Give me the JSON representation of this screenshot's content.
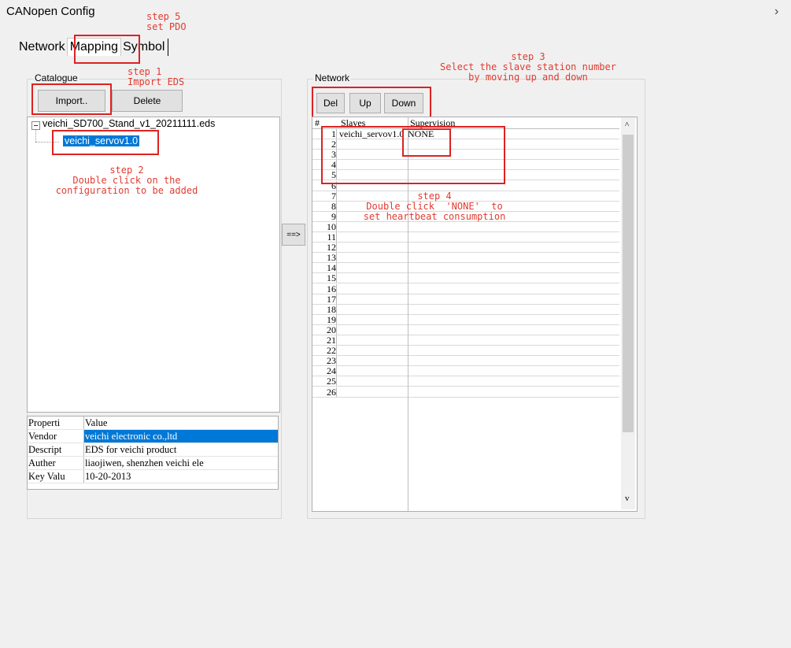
{
  "window": {
    "title": "CANopen Config",
    "close_glyph": "›"
  },
  "tabs": [
    {
      "label": "Network"
    },
    {
      "label": "Mapping"
    },
    {
      "label": "Symbol"
    }
  ],
  "catalogue": {
    "label": "Catalogue",
    "import_label": "Import..",
    "delete_label": "Delete",
    "tree_root": "veichi_SD700_Stand_v1_20211111.eds",
    "tree_child": "veichi_servov1.0",
    "properties": {
      "header": [
        "Properti",
        "Value"
      ],
      "rows": [
        [
          "Vendor",
          "veichi electronic co.,ltd"
        ],
        [
          "Descript",
          "EDS for veichi product"
        ],
        [
          "Auther",
          "liaojiwen, shenzhen veichi ele"
        ],
        [
          "Key Valu",
          "10-20-2013"
        ]
      ]
    }
  },
  "transfer_button": "==>",
  "network": {
    "label": "Network",
    "del_label": "Del",
    "up_label": "Up",
    "down_label": "Down",
    "columns": [
      "#",
      "Slaves",
      "Supervision"
    ],
    "rows": [
      {
        "n": "1",
        "slave": "veichi_servov1.0",
        "sup": "NONE"
      },
      {
        "n": "2",
        "slave": "",
        "sup": ""
      },
      {
        "n": "3",
        "slave": "",
        "sup": ""
      },
      {
        "n": "4",
        "slave": "",
        "sup": ""
      },
      {
        "n": "5",
        "slave": "",
        "sup": ""
      },
      {
        "n": "6",
        "slave": "",
        "sup": ""
      },
      {
        "n": "7",
        "slave": "",
        "sup": ""
      },
      {
        "n": "8",
        "slave": "",
        "sup": ""
      },
      {
        "n": "9",
        "slave": "",
        "sup": ""
      },
      {
        "n": "10",
        "slave": "",
        "sup": ""
      },
      {
        "n": "11",
        "slave": "",
        "sup": ""
      },
      {
        "n": "12",
        "slave": "",
        "sup": ""
      },
      {
        "n": "13",
        "slave": "",
        "sup": ""
      },
      {
        "n": "14",
        "slave": "",
        "sup": ""
      },
      {
        "n": "15",
        "slave": "",
        "sup": ""
      },
      {
        "n": "16",
        "slave": "",
        "sup": ""
      },
      {
        "n": "17",
        "slave": "",
        "sup": ""
      },
      {
        "n": "18",
        "slave": "",
        "sup": ""
      },
      {
        "n": "19",
        "slave": "",
        "sup": ""
      },
      {
        "n": "20",
        "slave": "",
        "sup": ""
      },
      {
        "n": "21",
        "slave": "",
        "sup": ""
      },
      {
        "n": "22",
        "slave": "",
        "sup": ""
      },
      {
        "n": "23",
        "slave": "",
        "sup": ""
      },
      {
        "n": "24",
        "slave": "",
        "sup": ""
      },
      {
        "n": "25",
        "slave": "",
        "sup": ""
      },
      {
        "n": "26",
        "slave": "",
        "sup": ""
      }
    ],
    "scroll_up": "^",
    "scroll_down": "v"
  },
  "annotations": {
    "step5": "step 5\nset PDO",
    "step1": "step 1\nImport EDS",
    "step2": "step 2\nDouble click on the\nconfiguration to be added",
    "step3": "step 3\nSelect the slave station number\nby moving up and down",
    "step4": "step 4\nDouble click  'NONE'  to\nset heartbeat consumption"
  },
  "icons": {
    "tree_toggle": "minus-box-icon"
  },
  "colors": {
    "annotation": "#e03c31",
    "selection": "#0078d7"
  }
}
